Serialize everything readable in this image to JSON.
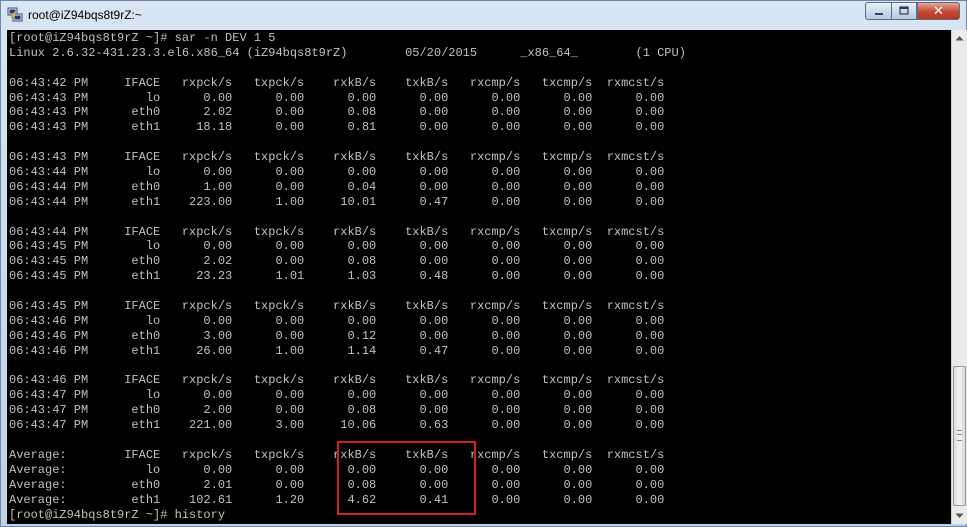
{
  "window": {
    "title": "root@iZ94bqs8t9rZ:~",
    "icons": {
      "app": "putty-icon",
      "minimize": "minimize-icon",
      "maximize": "maximize-icon",
      "close": "close-icon"
    },
    "controls": {
      "close_glyph": "✕"
    }
  },
  "terminal": {
    "lines": [
      "[root@iZ94bqs8t9rZ ~]# sar -n DEV 1 5",
      "Linux 2.6.32-431.23.3.el6.x86_64 (iZ94bqs8t9rZ)        05/20/2015      _x86_64_        (1 CPU)",
      "",
      "06:43:42 PM     IFACE   rxpck/s   txpck/s    rxkB/s    txkB/s   rxcmp/s   txcmp/s  rxmcst/s",
      "06:43:43 PM        lo      0.00      0.00      0.00      0.00      0.00      0.00      0.00",
      "06:43:43 PM      eth0      2.02      0.00      0.08      0.00      0.00      0.00      0.00",
      "06:43:43 PM      eth1     18.18      0.00      0.81      0.00      0.00      0.00      0.00",
      "",
      "06:43:43 PM     IFACE   rxpck/s   txpck/s    rxkB/s    txkB/s   rxcmp/s   txcmp/s  rxmcst/s",
      "06:43:44 PM        lo      0.00      0.00      0.00      0.00      0.00      0.00      0.00",
      "06:43:44 PM      eth0      1.00      0.00      0.04      0.00      0.00      0.00      0.00",
      "06:43:44 PM      eth1    223.00      1.00     10.01      0.47      0.00      0.00      0.00",
      "",
      "06:43:44 PM     IFACE   rxpck/s   txpck/s    rxkB/s    txkB/s   rxcmp/s   txcmp/s  rxmcst/s",
      "06:43:45 PM        lo      0.00      0.00      0.00      0.00      0.00      0.00      0.00",
      "06:43:45 PM      eth0      2.02      0.00      0.08      0.00      0.00      0.00      0.00",
      "06:43:45 PM      eth1     23.23      1.01      1.03      0.48      0.00      0.00      0.00",
      "",
      "06:43:45 PM     IFACE   rxpck/s   txpck/s    rxkB/s    txkB/s   rxcmp/s   txcmp/s  rxmcst/s",
      "06:43:46 PM        lo      0.00      0.00      0.00      0.00      0.00      0.00      0.00",
      "06:43:46 PM      eth0      3.00      0.00      0.12      0.00      0.00      0.00      0.00",
      "06:43:46 PM      eth1     26.00      1.00      1.14      0.47      0.00      0.00      0.00",
      "",
      "06:43:46 PM     IFACE   rxpck/s   txpck/s    rxkB/s    txkB/s   rxcmp/s   txcmp/s  rxmcst/s",
      "06:43:47 PM        lo      0.00      0.00      0.00      0.00      0.00      0.00      0.00",
      "06:43:47 PM      eth0      2.00      0.00      0.08      0.00      0.00      0.00      0.00",
      "06:43:47 PM      eth1    221.00      3.00     10.06      0.63      0.00      0.00      0.00",
      "",
      "Average:        IFACE   rxpck/s   txpck/s    rxkB/s    txkB/s   rxcmp/s   txcmp/s  rxmcst/s",
      "Average:           lo      0.00      0.00      0.00      0.00      0.00      0.00      0.00",
      "Average:         eth0      2.01      0.00      0.08      0.00      0.00      0.00      0.00",
      "Average:         eth1    102.61      1.20      4.62      0.41      0.00      0.00      0.00",
      "[root@iZ94bqs8t9rZ ~]# history"
    ],
    "colors": {
      "background": "#000000",
      "foreground": "#c0c0c0",
      "highlight_border": "#d21f1f"
    }
  },
  "scrollbar": {
    "up_arrow": "▲",
    "down_arrow": "▼"
  }
}
